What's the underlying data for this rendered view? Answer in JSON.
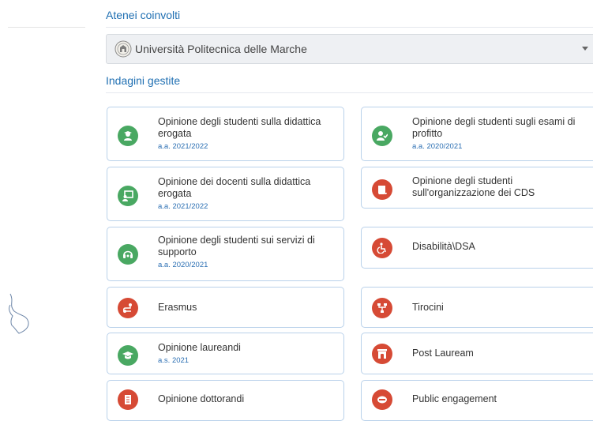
{
  "sections": {
    "atenei_title": "Atenei coinvolti",
    "indagini_title": "Indagini gestite"
  },
  "ateneo_select": {
    "value": "Università Politecnica delle Marche",
    "icon": "university-seal-icon"
  },
  "cards": [
    {
      "title": "Opinione degli studenti sulla didattica erogata",
      "year": "a.a. 2021/2022",
      "color": "#49a862",
      "icon": "student-graduate-icon"
    },
    {
      "title": "Opinione degli studenti sugli esami di profitto",
      "year": "a.a. 2020/2021",
      "color": "#49a862",
      "icon": "user-check-icon"
    },
    {
      "title": "Opinione dei docenti sulla didattica erogata",
      "year": "a.a. 2021/2022",
      "color": "#49a862",
      "icon": "teacher-board-icon"
    },
    {
      "title": "Opinione degli studenti sull'organizzazione dei CDS",
      "year": "",
      "color": "#d64a35",
      "icon": "scroll-icon"
    },
    {
      "title": "Opinione degli studenti sui servizi di supporto",
      "year": "a.a. 2020/2021",
      "color": "#49a862",
      "icon": "headset-icon"
    },
    {
      "title": "Disabilità\\DSA",
      "year": "",
      "color": "#d64a35",
      "icon": "wheelchair-icon"
    },
    {
      "title": "Erasmus",
      "year": "",
      "color": "#d64a35",
      "icon": "route-icon"
    },
    {
      "title": "Tirocini",
      "year": "",
      "color": "#d64a35",
      "icon": "sitemap-icon"
    },
    {
      "title": "Opinione laureandi",
      "year": "a.s. 2021",
      "color": "#49a862",
      "icon": "graduation-cap-icon"
    },
    {
      "title": "Post Lauream",
      "year": "",
      "color": "#d64a35",
      "icon": "archway-icon"
    },
    {
      "title": "Opinione dottorandi",
      "year": "",
      "color": "#d64a35",
      "icon": "document-icon"
    },
    {
      "title": "Public engagement",
      "year": "",
      "color": "#d64a35",
      "icon": "megaphone-icon"
    }
  ]
}
